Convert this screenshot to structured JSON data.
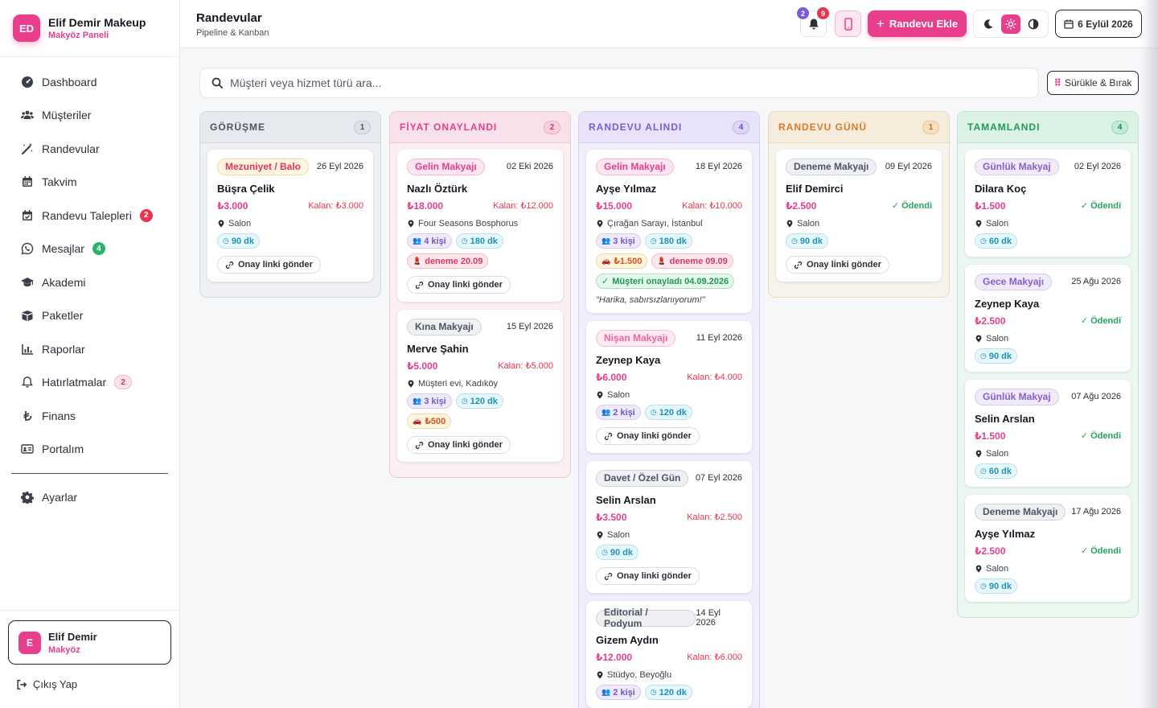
{
  "brand": {
    "initials": "ED",
    "name": "Elif Demir Makeup",
    "subtitle": "Makyöz Paneli"
  },
  "nav": [
    {
      "label": "Dashboard",
      "icon": "dashboard-icon"
    },
    {
      "label": "Müşteriler",
      "icon": "users-icon"
    },
    {
      "label": "Randevular",
      "icon": "magic-wand-icon"
    },
    {
      "label": "Takvim",
      "icon": "calendar-icon"
    },
    {
      "label": "Randevu Talepleri",
      "icon": "calendar-check-icon",
      "badge": "2"
    },
    {
      "label": "Mesajlar",
      "icon": "whatsapp-icon",
      "badge": "4"
    },
    {
      "label": "Akademi",
      "icon": "graduation-cap-icon"
    },
    {
      "label": "Paketler",
      "icon": "box-icon"
    },
    {
      "label": "Raporlar",
      "icon": "chart-icon"
    },
    {
      "label": "Hatırlatmalar",
      "icon": "bell-icon",
      "badge": "2"
    },
    {
      "label": "Finans",
      "icon": "lira-icon"
    },
    {
      "label": "Portalım",
      "icon": "id-card-icon"
    },
    {
      "label": "Ayarlar",
      "icon": "gear-icon"
    }
  ],
  "user": {
    "initial": "E",
    "name": "Elif Demir",
    "role": "Makyöz"
  },
  "logout_label": "Çıkış Yap",
  "header": {
    "title": "Randevular",
    "subtitle": "Pipeline & Kanban",
    "notif_count_a": "2",
    "notif_count_b": "9",
    "add_label": "Randevu Ekle",
    "date_label": "6 Eylül 2026"
  },
  "search": {
    "placeholder": "Müşteri veya hizmet türü ara..."
  },
  "drag_label": "Sürükle & Bırak",
  "colors": {
    "accent": "#e83e8c",
    "danger": "#e8344e",
    "success": "#27a35e"
  },
  "columns": [
    {
      "title": "GÖRÜŞME",
      "count": "1",
      "cards": [
        {
          "tag": "Mezuniyet / Balo",
          "date": "26 Eyl 2026",
          "name": "Büşra Çelik",
          "price": "₺3.000",
          "remaining": "Kalan: ₺3.000",
          "location": "Salon",
          "duration": "90 dk",
          "link": "Onay linki gönder"
        }
      ]
    },
    {
      "title": "FİYAT ONAYLANDI",
      "count": "2",
      "cards": [
        {
          "tag": "Gelin Makyajı",
          "date": "02 Eki 2026",
          "name": "Nazlı Öztürk",
          "price": "₺18.000",
          "remaining": "Kalan: ₺12.000",
          "location": "Four Seasons Bosphorus",
          "people": "4 kişi",
          "duration": "180 dk",
          "trial": "deneme 20.09",
          "link": "Onay linki gönder"
        },
        {
          "tag": "Kına Makyajı",
          "date": "15 Eyl 2026",
          "name": "Merve Şahin",
          "price": "₺5.000",
          "remaining": "Kalan: ₺5.000",
          "location": "Müşteri evi, Kadıköy",
          "people": "3 kişi",
          "duration": "120 dk",
          "travel": "₺500",
          "link": "Onay linki gönder"
        }
      ]
    },
    {
      "title": "RANDEVU ALINDI",
      "count": "4",
      "cards": [
        {
          "tag": "Gelin Makyajı",
          "date": "18 Eyl 2026",
          "name": "Ayşe Yılmaz",
          "price": "₺15.000",
          "remaining": "Kalan: ₺10.000",
          "location": "Çırağan Sarayı, İstanbul",
          "people": "3 kişi",
          "duration": "180 dk",
          "travel": "₺1.500",
          "trial": "deneme 09.09",
          "approved": "Müşteri onayladı 04.09.2026",
          "quote": "\"Harika, sabırsızlanıyorum!\""
        },
        {
          "tag": "Nişan Makyajı",
          "date": "11 Eyl 2026",
          "name": "Zeynep Kaya",
          "price": "₺6.000",
          "remaining": "Kalan: ₺4.000",
          "location": "Salon",
          "people": "2 kişi",
          "duration": "120 dk",
          "link": "Onay linki gönder"
        },
        {
          "tag": "Davet / Özel Gün",
          "date": "07 Eyl 2026",
          "name": "Selin Arslan",
          "price": "₺3.500",
          "remaining": "Kalan: ₺2.500",
          "location": "Salon",
          "duration": "90 dk",
          "link": "Onay linki gönder"
        },
        {
          "tag": "Editorial / Podyum",
          "date": "14 Eyl 2026",
          "name": "Gizem Aydın",
          "price": "₺12.000",
          "remaining": "Kalan: ₺6.000",
          "location": "Stüdyo, Beyoğlu",
          "people": "2 kişi",
          "duration": "120 dk"
        }
      ]
    },
    {
      "title": "RANDEVU GÜNÜ",
      "count": "1",
      "cards": [
        {
          "tag": "Deneme Makyajı",
          "date": "09 Eyl 2026",
          "name": "Elif Demirci",
          "price": "₺2.500",
          "paid": "Ödendi",
          "location": "Salon",
          "duration": "90 dk",
          "link": "Onay linki gönder"
        }
      ]
    },
    {
      "title": "TAMAMLANDI",
      "count": "4",
      "cards": [
        {
          "tag": "Günlük Makyaj",
          "date": "02 Eyl 2026",
          "name": "Dilara Koç",
          "price": "₺1.500",
          "paid": "Ödendi",
          "location": "Salon",
          "duration": "60 dk"
        },
        {
          "tag": "Gece Makyajı",
          "date": "25 Ağu 2026",
          "name": "Zeynep Kaya",
          "price": "₺2.500",
          "paid": "Ödendi",
          "location": "Salon",
          "duration": "90 dk"
        },
        {
          "tag": "Günlük Makyaj",
          "date": "07 Ağu 2026",
          "name": "Selin Arslan",
          "price": "₺1.500",
          "paid": "Ödendi",
          "location": "Salon",
          "duration": "60 dk"
        },
        {
          "tag": "Deneme Makyajı",
          "date": "17 Ağu 2026",
          "name": "Ayşe Yılmaz",
          "price": "₺2.500",
          "paid": "Ödendi",
          "location": "Salon",
          "duration": "90 dk"
        }
      ]
    }
  ]
}
